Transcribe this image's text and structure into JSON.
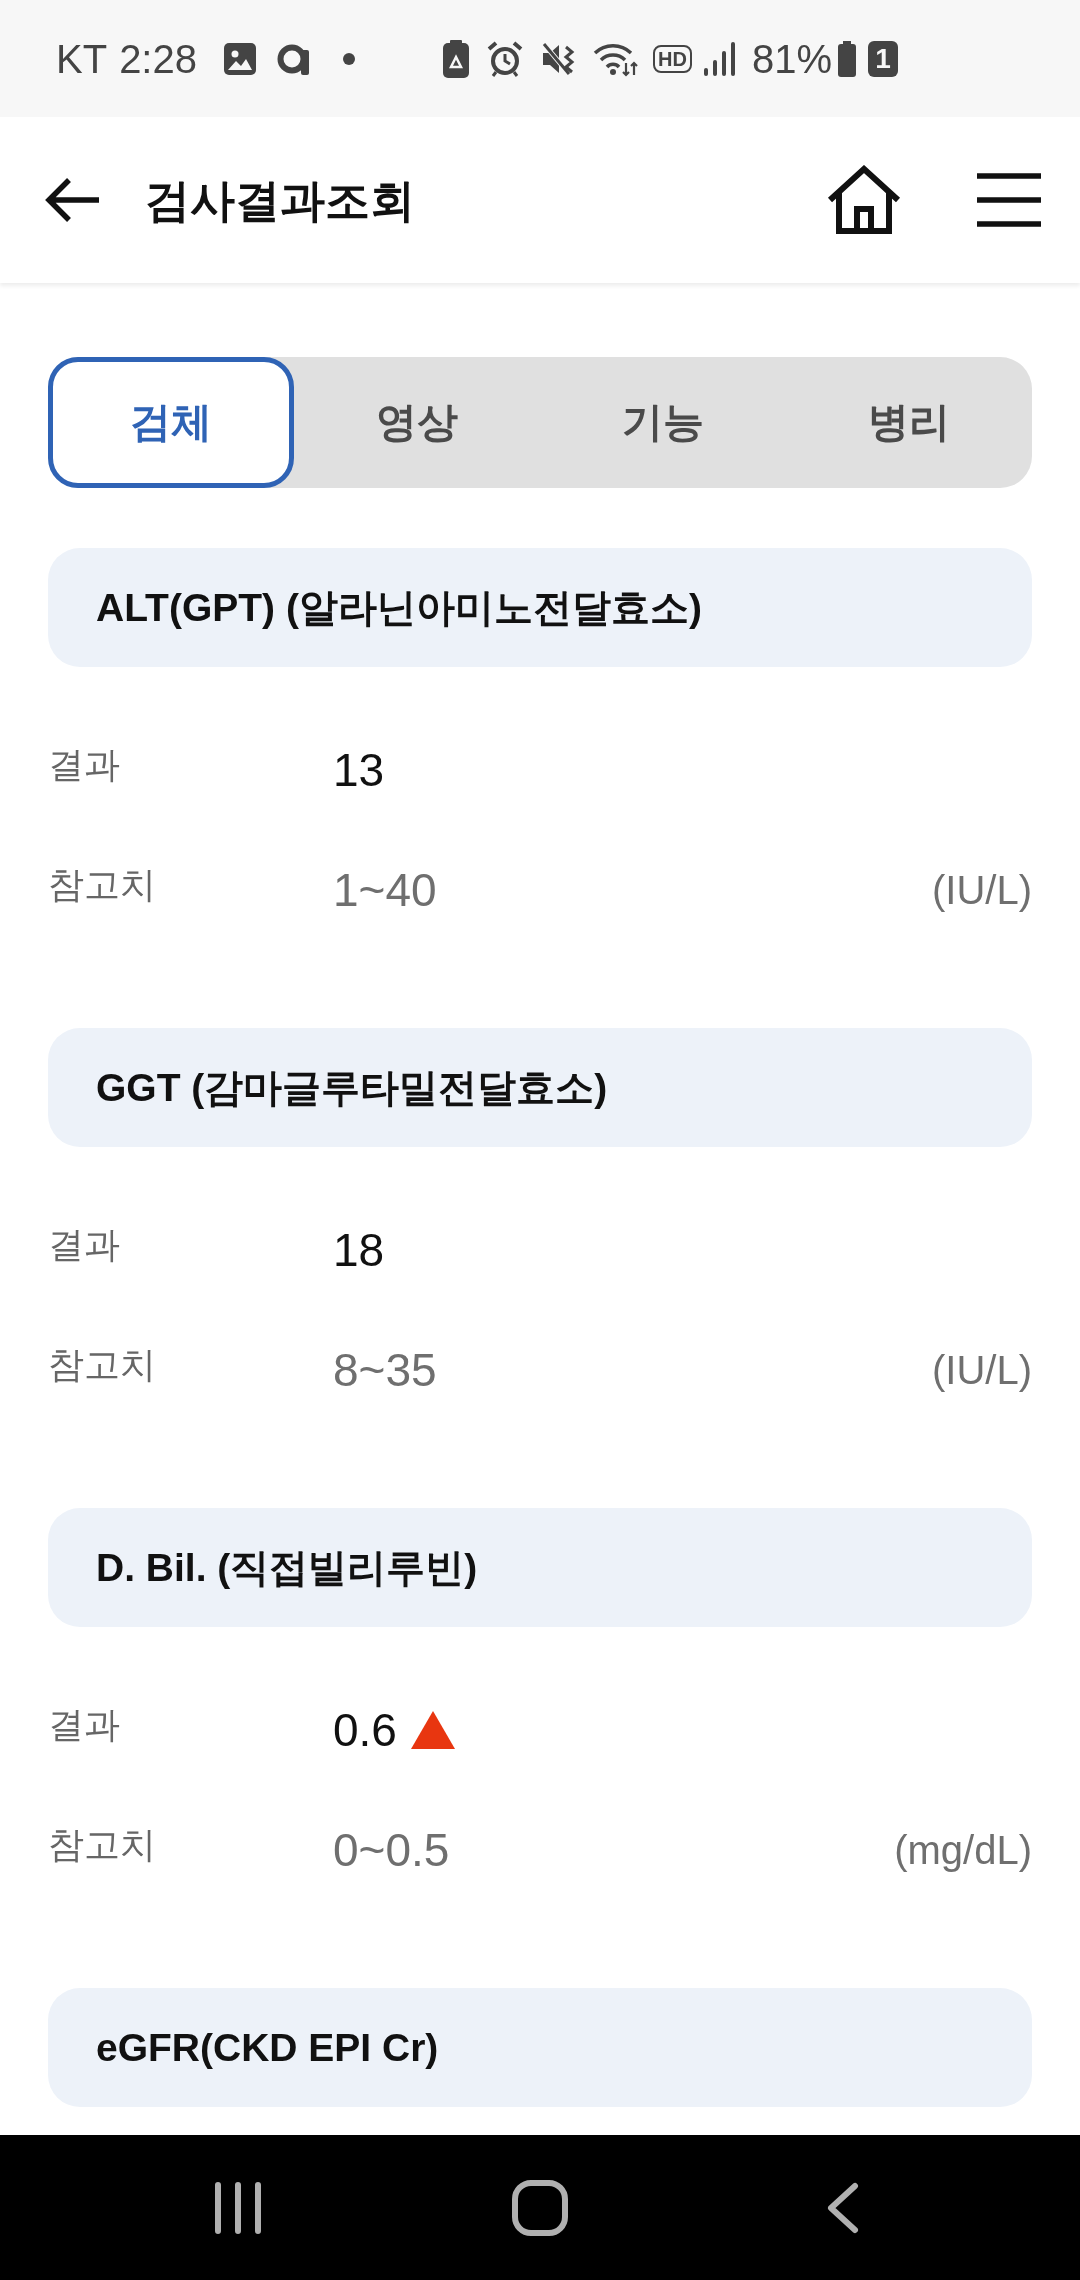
{
  "status_bar": {
    "carrier": "KT",
    "time": "2:28",
    "hd_voice": "HD",
    "battery": "81%",
    "sim_slot": "1"
  },
  "header": {
    "title": "검사결과조회"
  },
  "tabs": [
    {
      "label": "검체",
      "selected": true
    },
    {
      "label": "영상",
      "selected": false
    },
    {
      "label": "기능",
      "selected": false
    },
    {
      "label": "병리",
      "selected": false
    }
  ],
  "tests": [
    {
      "name": "ALT(GPT) (알라닌아미노전달효소)",
      "result_label": "결과",
      "result": "13",
      "high": false,
      "reference_label": "참고치",
      "reference": "1~40",
      "unit": "(IU/L)"
    },
    {
      "name": "GGT (감마글루타밀전달효소)",
      "result_label": "결과",
      "result": "18",
      "high": false,
      "reference_label": "참고치",
      "reference": "8~35",
      "unit": "(IU/L)"
    },
    {
      "name": "D. Bil. (직접빌리루빈)",
      "result_label": "결과",
      "result": "0.6",
      "high": true,
      "reference_label": "참고치",
      "reference": "0~0.5",
      "unit": "(mg/dL)"
    },
    {
      "name": "eGFR(CKD EPI Cr)"
    }
  ]
}
